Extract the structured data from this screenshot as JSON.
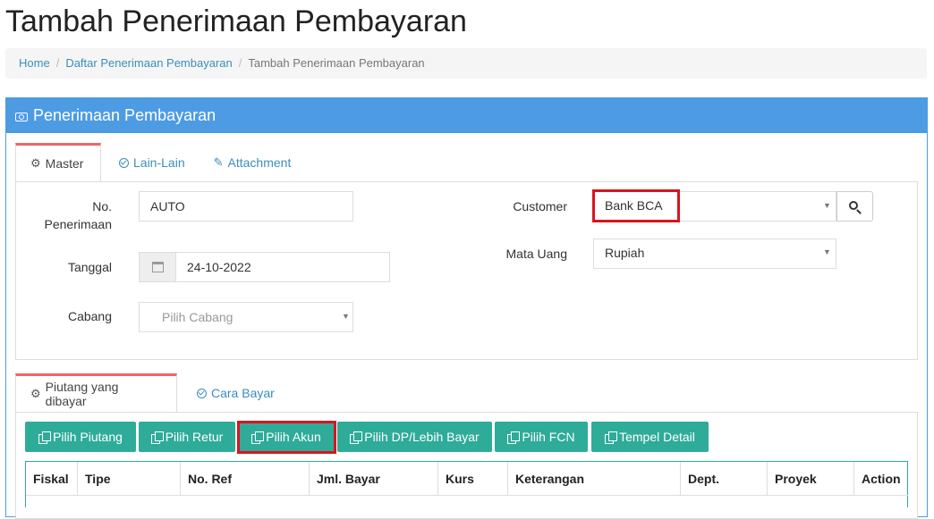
{
  "page_title": "Tambah Penerimaan Pembayaran",
  "breadcrumb": {
    "items": [
      "Home",
      "Daftar Penerimaan Pembayaran",
      "Tambah Penerimaan Pembayaran"
    ],
    "separator": "/"
  },
  "panel": {
    "title": "Penerimaan Pembayaran",
    "header_color": "#4d9be3"
  },
  "top_tabs": [
    {
      "label": "Master",
      "icon": "gears-icon",
      "active": true
    },
    {
      "label": "Lain-Lain",
      "icon": "check-circle-icon",
      "active": false
    },
    {
      "label": "Attachment",
      "icon": "paperclip-icon",
      "active": false
    }
  ],
  "form": {
    "no_penerimaan": {
      "label_line1": "No.",
      "label_line2": "Penerimaan",
      "value": "AUTO"
    },
    "tanggal": {
      "label": "Tanggal",
      "value": "24-10-2022"
    },
    "cabang": {
      "label": "Cabang",
      "placeholder": "Pilih Cabang"
    },
    "customer": {
      "label": "Customer",
      "value": "Bank BCA"
    },
    "mata_uang": {
      "label": "Mata Uang",
      "value": "Rupiah"
    }
  },
  "bottom_tabs": [
    {
      "label": "Piutang yang dibayar",
      "icon": "gears-icon",
      "active": true
    },
    {
      "label": "Cara Bayar",
      "icon": "check-circle-icon",
      "active": false
    }
  ],
  "buttons": {
    "pilih_piutang": "Pilih Piutang",
    "pilih_retur": "Pilih Retur",
    "pilih_akun": "Pilih Akun",
    "pilih_dp": "Pilih DP/Lebih Bayar",
    "pilih_fcn": "Pilih FCN",
    "tempel_detail": "Tempel Detail",
    "color": "#2fab9a"
  },
  "table": {
    "columns": [
      "Fiskal",
      "Tipe",
      "No. Ref",
      "Jml. Bayar",
      "Kurs",
      "Keterangan",
      "Dept.",
      "Proyek",
      "Action"
    ]
  },
  "highlight_color": "#d9141f"
}
